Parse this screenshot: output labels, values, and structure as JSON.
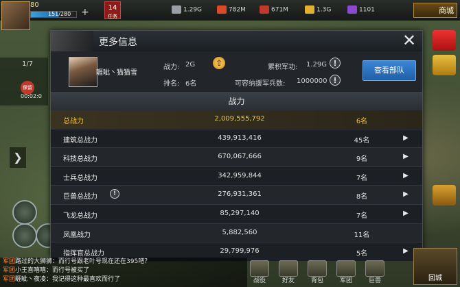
{
  "hud": {
    "vip_label": "80",
    "hp_text": "151/280",
    "badge_number": "14",
    "badge_sub": "任务",
    "resources": [
      {
        "name": "steel-icon",
        "value": "1.29G",
        "color": "#9aa0a6"
      },
      {
        "name": "food-icon",
        "value": "782M",
        "color": "#d94a2a"
      },
      {
        "name": "gift-icon",
        "value": "671M",
        "color": "#c0392b"
      },
      {
        "name": "gold-bar-icon",
        "value": "1.3G",
        "color": "#e0b030"
      },
      {
        "name": "diamond-icon",
        "value": "1101",
        "color": "#8a4ad0"
      }
    ],
    "shop_label": "商城",
    "left_page": "1/7",
    "left_status": "保留",
    "left_time": "00:02:0"
  },
  "modal": {
    "title": "更多信息",
    "player_name": "睚眦丶猫猫雪",
    "power_label": "战力:",
    "power_value": "2G",
    "rank_label": "排名:",
    "rank_value": "6名",
    "merit_label": "累积军功:",
    "merit_value": "1.29G",
    "reinforce_label": "可容纳援军兵数:",
    "reinforce_value": "1000000",
    "view_troops_label": "查看部队",
    "section_title": "战力",
    "rows": [
      {
        "name": "总战力",
        "value": "2,009,555,792",
        "rank": "6名",
        "arrow": false,
        "info": false,
        "highlight": true
      },
      {
        "name": "建筑总战力",
        "value": "439,913,416",
        "rank": "45名",
        "arrow": true,
        "info": false,
        "highlight": false
      },
      {
        "name": "科技总战力",
        "value": "670,067,666",
        "rank": "9名",
        "arrow": true,
        "info": false,
        "highlight": false
      },
      {
        "name": "士兵总战力",
        "value": "342,959,844",
        "rank": "7名",
        "arrow": true,
        "info": false,
        "highlight": false
      },
      {
        "name": "巨兽总战力",
        "value": "276,931,361",
        "rank": "8名",
        "arrow": true,
        "info": true,
        "highlight": false
      },
      {
        "name": "飞龙总战力",
        "value": "85,297,140",
        "rank": "7名",
        "arrow": true,
        "info": false,
        "highlight": false
      },
      {
        "name": "凤凰战力",
        "value": "5,882,560",
        "rank": "11名",
        "arrow": false,
        "info": false,
        "highlight": false
      },
      {
        "name": "指挥官总战力",
        "value": "29,799,976",
        "rank": "5名",
        "arrow": true,
        "info": false,
        "highlight": false
      }
    ]
  },
  "chat": [
    {
      "tag": "军团",
      "text": "路过的大狮狮：而行号跟老叶号现在还在395吧？"
    },
    {
      "tag": "军团",
      "text": "小王喜嘻嘻：而行号被买了"
    },
    {
      "tag": "军团",
      "text": "睚眦丶夜凌：我记得这种最喜欢而行了"
    }
  ],
  "bottom_nav": [
    {
      "label": "战役",
      "name": "nav-campaign"
    },
    {
      "label": "好友",
      "name": "nav-friends"
    },
    {
      "label": "背包",
      "name": "nav-bag"
    },
    {
      "label": "军团",
      "name": "nav-legion"
    },
    {
      "label": "巨兽",
      "name": "nav-beast"
    }
  ],
  "home_label": "回城"
}
